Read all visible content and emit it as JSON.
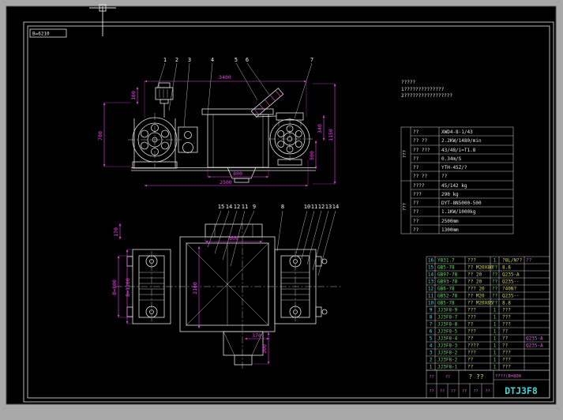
{
  "frame": {
    "ref_label": "B=6210"
  },
  "notes": {
    "title": "?????",
    "line1": "1??????????????",
    "line2": "2?????????????????"
  },
  "top_view": {
    "balloons": [
      "1",
      "2",
      "3",
      "4",
      "5",
      "6",
      "7"
    ],
    "dims": {
      "total": "3400",
      "motor_h": "160",
      "left_h": "780",
      "right_h": "1150",
      "d340": "340",
      "d500": "500",
      "d800": "800",
      "d2500": "2500"
    }
  },
  "plan_view": {
    "balloons_left": [
      "15",
      "14",
      "12",
      "11"
    ],
    "balloon_mid": "9",
    "balloon_8": "8",
    "balloons_right": [
      "10",
      "11",
      "12",
      "13",
      "14"
    ],
    "dims": {
      "d170": "170",
      "belt": "B=800",
      "frame": "B=1300",
      "d2160": "2160",
      "d800": "800",
      "d370": "370",
      "d300": "300"
    }
  },
  "spec_table": {
    "group1": "???",
    "group2": "???",
    "rows": [
      {
        "label": "??",
        "value": "XWD4-8-1/43"
      },
      {
        "label": "?? ??",
        "value": "2.2KW/1480/min"
      },
      {
        "label": "?? ???",
        "value": "43/48/i=T1.8"
      },
      {
        "label": "??",
        "value": "0.34m/S"
      },
      {
        "label": "??",
        "value": "YTH-45Z/?"
      },
      {
        "label": "?? ??",
        "value": "??"
      },
      {
        "label": "????",
        "value": "45/142 kg"
      },
      {
        "label": "???",
        "value": "290 kg"
      },
      {
        "label": "??",
        "value": "DYT-8N5000-500"
      },
      {
        "label": "??",
        "value": "1.1KW/1000kg"
      },
      {
        "label": "??",
        "value": "2500mm"
      },
      {
        "label": "??",
        "value": "1300mm"
      }
    ]
  },
  "bom": {
    "rows": [
      {
        "no": "16",
        "code": "Y831.7",
        "name": "???",
        "qty": "1",
        "mat": "?8L/N??",
        "note": "??"
      },
      {
        "no": "15",
        "code": "GB5-78",
        "name": "?? M20X80",
        "qty": "??",
        "mat": "8.8",
        "note": ""
      },
      {
        "no": "14",
        "code": "GB97-78",
        "name": "?? 20",
        "qty": "??",
        "mat": "Q235-A",
        "note": ""
      },
      {
        "no": "13",
        "code": "GB93-78",
        "name": "?? 20",
        "qty": "??",
        "mat": "Q235--",
        "note": ""
      },
      {
        "no": "12",
        "code": "GB6-78",
        "name": "??? 20",
        "qty": "??",
        "mat": "?40N?",
        "note": ""
      },
      {
        "no": "11",
        "code": "GB52-78",
        "name": "?? M20",
        "qty": "??",
        "mat": "Q235--",
        "note": ""
      },
      {
        "no": "10",
        "code": "GB5-78",
        "name": "?? M20X65",
        "qty": "??",
        "mat": "8.8",
        "note": ""
      },
      {
        "no": "9",
        "code": "JJ3F8-9",
        "name": "???",
        "qty": "1",
        "mat": "???",
        "note": ""
      },
      {
        "no": "8",
        "code": "JJ3F8-7",
        "name": "???",
        "qty": "1",
        "mat": "???",
        "note": ""
      },
      {
        "no": "7",
        "code": "JJ3F8-8",
        "name": "??",
        "qty": "1",
        "mat": "???",
        "note": ""
      },
      {
        "no": "6",
        "code": "JJ3F8-5",
        "name": "???",
        "qty": "1",
        "mat": "??",
        "note": ""
      },
      {
        "no": "5",
        "code": "JJ3F8-4",
        "name": "??",
        "qty": "1",
        "mat": "??",
        "note": "Q235-A"
      },
      {
        "no": "4",
        "code": "JJ3F8-3",
        "name": "????",
        "qty": "1",
        "mat": "??",
        "note": "Q235-A"
      },
      {
        "no": "3",
        "code": "JJ3F8-2",
        "name": "???",
        "qty": "1",
        "mat": "???",
        "note": ""
      },
      {
        "no": "2",
        "code": "JJ3F8-2",
        "name": "??",
        "qty": "1",
        "mat": "???",
        "note": ""
      },
      {
        "no": "1",
        "code": "JJ3F8-1",
        "name": "??",
        "qty": "1",
        "mat": "???",
        "note": ""
      }
    ]
  },
  "title_block": {
    "product": "????(B=800",
    "model": "DTJ3F8",
    "mid": "? ??",
    "cells": [
      "??",
      "??",
      "??",
      "??",
      "??",
      "??",
      "??",
      "??"
    ]
  },
  "colors": {
    "dimension": "#ee44ee",
    "geometry": "#e2e2e2",
    "model_text": "#45d6d6",
    "bom_code": "#6cd86c",
    "bom_no": "#5fd8d8"
  }
}
